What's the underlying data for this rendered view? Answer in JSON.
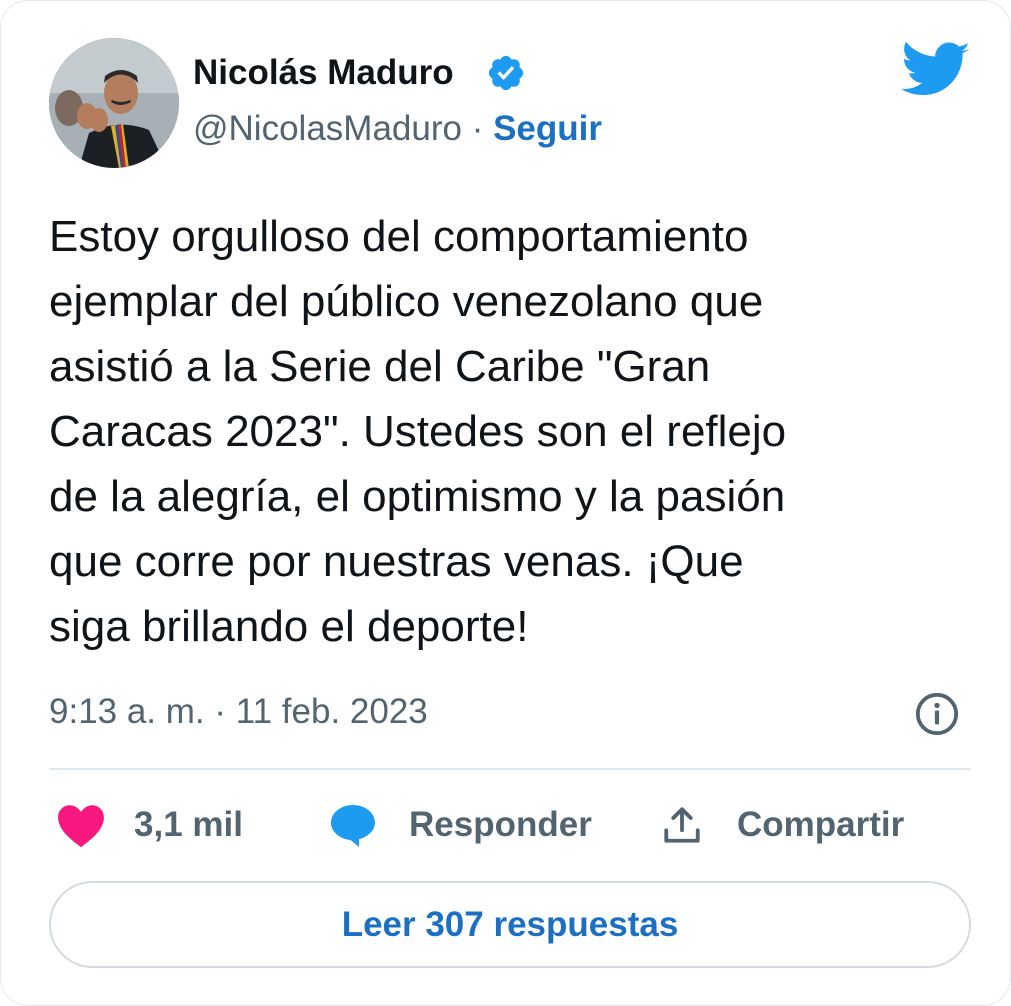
{
  "tweet": {
    "author_name": "Nicolás Maduro",
    "handle": "@NicolasMaduro",
    "separator": " · ",
    "follow_label": "Seguir",
    "text": "Estoy orgulloso del comportamiento\nejemplar del público venezolano que\nasistió a la Serie del Caribe \"Gran\nCaracas 2023\". Ustedes son el reflejo\nde la alegría, el optimismo y la pasión\nque corre por nuestras venas. ¡Que\nsiga brillando el deporte!",
    "timestamp": "9:13 a. m. · 11 feb. 2023"
  },
  "actions": {
    "like_count": "3,1 mil",
    "reply_label": "Responder",
    "share_label": "Compartir"
  },
  "read_replies_label": "Leer 307 respuestas",
  "icons": {
    "brand": "twitter-bird-icon",
    "verified": "verified-badge-icon",
    "info": "info-icon",
    "like": "heart-icon",
    "reply": "speech-bubble-icon",
    "share": "share-upload-icon"
  },
  "colors": {
    "link_blue": "#1d6fc2",
    "twitter_blue": "#1d9bf0",
    "heart_pink": "#f91880",
    "text_dark": "#0f1419",
    "text_gray": "#536471"
  }
}
